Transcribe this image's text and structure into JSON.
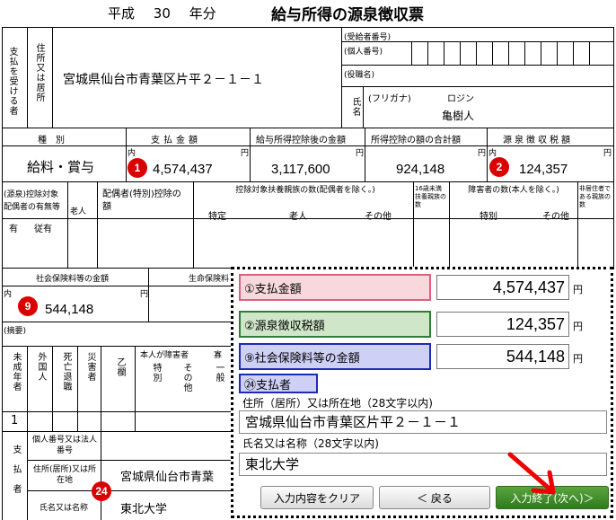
{
  "header": {
    "era": "平成",
    "year": "30",
    "suffix": "年分",
    "title": "給与所得の源泉徴収票"
  },
  "recipient": {
    "label_pay": "支払を受ける者",
    "label_address": "住所又は居所",
    "address": "宮城県仙台市青葉区片平２－１－１",
    "furigana_label": "(フリガナ)",
    "furigana": "ロジン",
    "name_label": "氏名",
    "name": "亀樹人",
    "small_labels": [
      "(受給者番号)",
      "(個人番号)",
      "(役職名)"
    ]
  },
  "money_header": [
    "種別",
    "支払金額",
    "給与所得控除後の金額",
    "所得控除の額の合計額",
    "源泉徴収税額"
  ],
  "money_row": {
    "type": "給料・賞与",
    "pay": "4,574,437",
    "after": "3,117,600",
    "deduct": "924,148",
    "tax": "124,357",
    "unit_in": "内",
    "unit_yen": "円"
  },
  "dep_header": [
    "(源泉)控除対象配偶者の有無等",
    "老人",
    "配偶者(特別)控除の額",
    "控除対象扶養親族の数(配偶者を除く。)",
    "16歳未満扶養親族の数",
    "障害者の数(本人を除く。)",
    "非居住者である親族の数"
  ],
  "dep_sub": [
    "有",
    "従有",
    "特定",
    "老人",
    "その他",
    "特別",
    "その他"
  ],
  "social": {
    "label": "社会保険料等の金額",
    "life_label": "生命保険料",
    "value": "544,148",
    "summary": "(摘要)"
  },
  "bottom_headers": [
    "未成年者",
    "外国人",
    "死亡退職",
    "災害者",
    "乙欄",
    "本人が障害者",
    "特別",
    "その他",
    "寡",
    "一般"
  ],
  "bottom_value": "1",
  "payer": {
    "label": "支払者",
    "number_label": "個人番号又は法人番号",
    "address_label": "住所(居所)又は所在地",
    "address": "宮城県仙台市青葉",
    "name_label": "氏名又は名称",
    "name": "東北大学"
  },
  "badges": [
    "1",
    "2",
    "9",
    "24"
  ],
  "panel": {
    "pay_label": "①支払金額",
    "pay_value": "4,574,437",
    "tax_label": "②源泉徴収税額",
    "tax_value": "124,357",
    "social_label": "⑨社会保険料等の金額",
    "social_value": "544,148",
    "yen": "円",
    "payer_label": "㉔支払者",
    "addr_label": "住所（居所）又は所在地（28文字以内)",
    "addr_value": "宮城県仙台市青葉区片平２－１－１",
    "name_label": "氏名又は名称（28文字以内)",
    "name_value": "東北大学",
    "btn_clear": "入力内容をクリア",
    "btn_back": "＜ 戻る",
    "btn_done": "入力終了(次へ)＞"
  },
  "colors": {
    "pink": "#f8d8dc",
    "green": "#cfe7c8",
    "lavender": "#cfd0f6",
    "badge": "#d90000",
    "arrow": "#ee0000",
    "done": "#3e8a28"
  }
}
